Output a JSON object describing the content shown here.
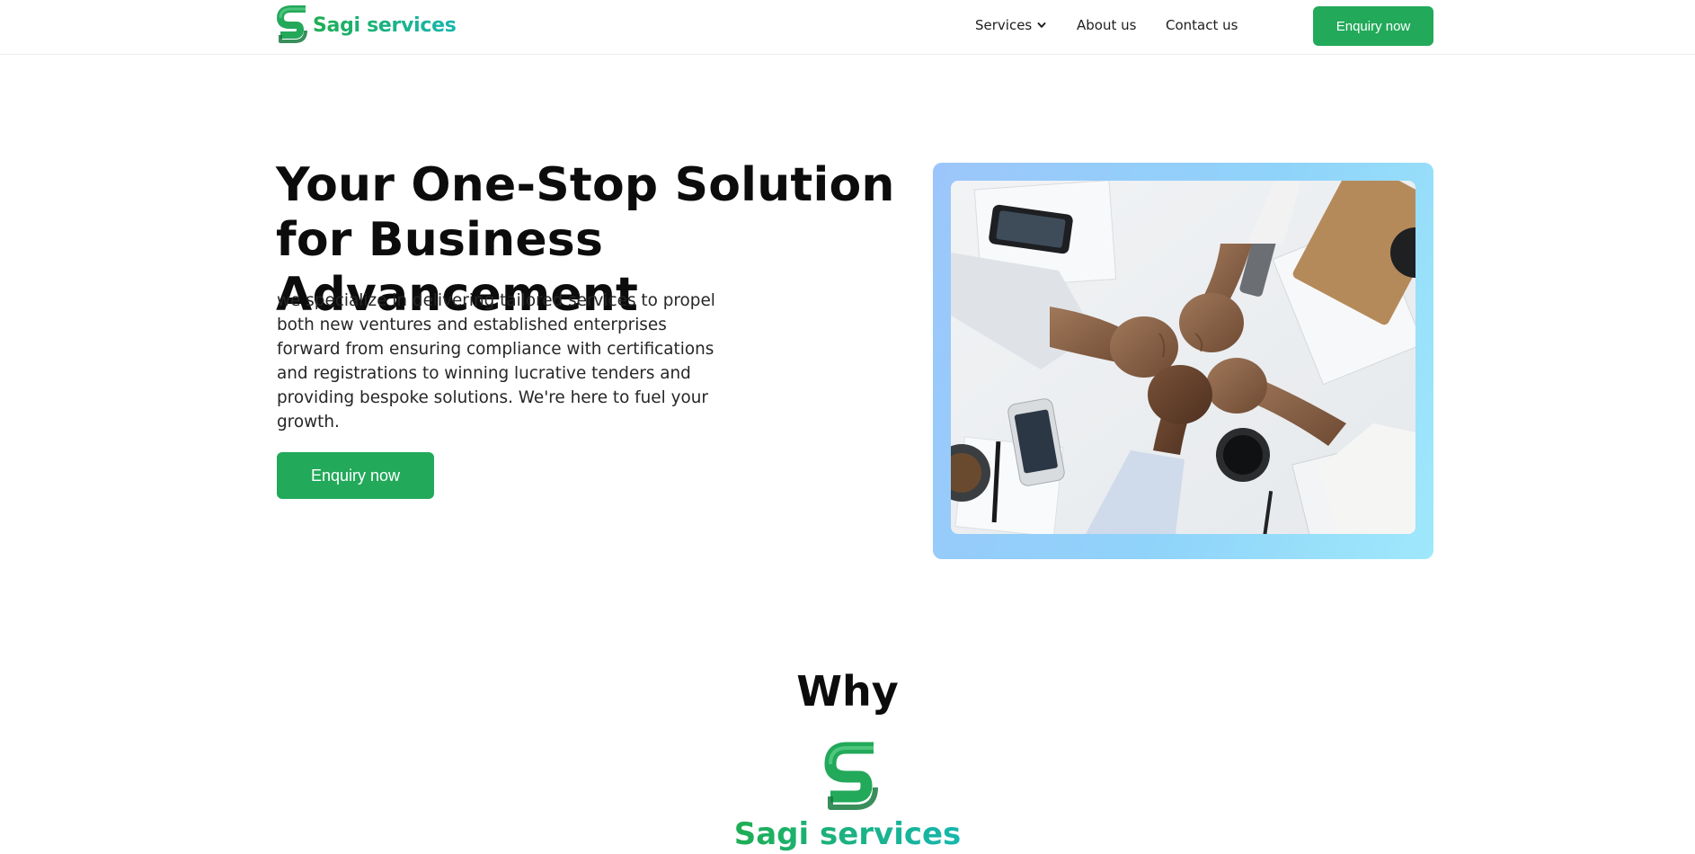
{
  "header": {
    "logo_icon": "s-logo-icon",
    "logo_text": "Sagi services",
    "nav": {
      "services_label": "Services",
      "services_icon": "chevron-down-icon",
      "about_label": "About us",
      "contact_label": "Contact us"
    },
    "cta_label": "Enquiry now"
  },
  "hero": {
    "title": "Your One-Stop Solution for Business Advancement",
    "description": "we specialize in delivering tailored services to propel both new ventures and established enterprises forward from ensuring compliance with certifications and registrations to winning lucrative tenders and providing bespoke solutions. We're here to fuel your growth.",
    "cta_label": "Enquiry now",
    "image_icon": "teamwork-fists-photo"
  },
  "why": {
    "heading": "Why",
    "logo_icon": "s-logo-icon",
    "brand": "Sagi services"
  },
  "colors": {
    "brand_green": "#22a95a",
    "brand_gradient_start": "#1fae53",
    "brand_gradient_end": "#17b6b0",
    "image_frame_blue": "#9cc6fb",
    "text_dark": "#0c0c0c"
  }
}
